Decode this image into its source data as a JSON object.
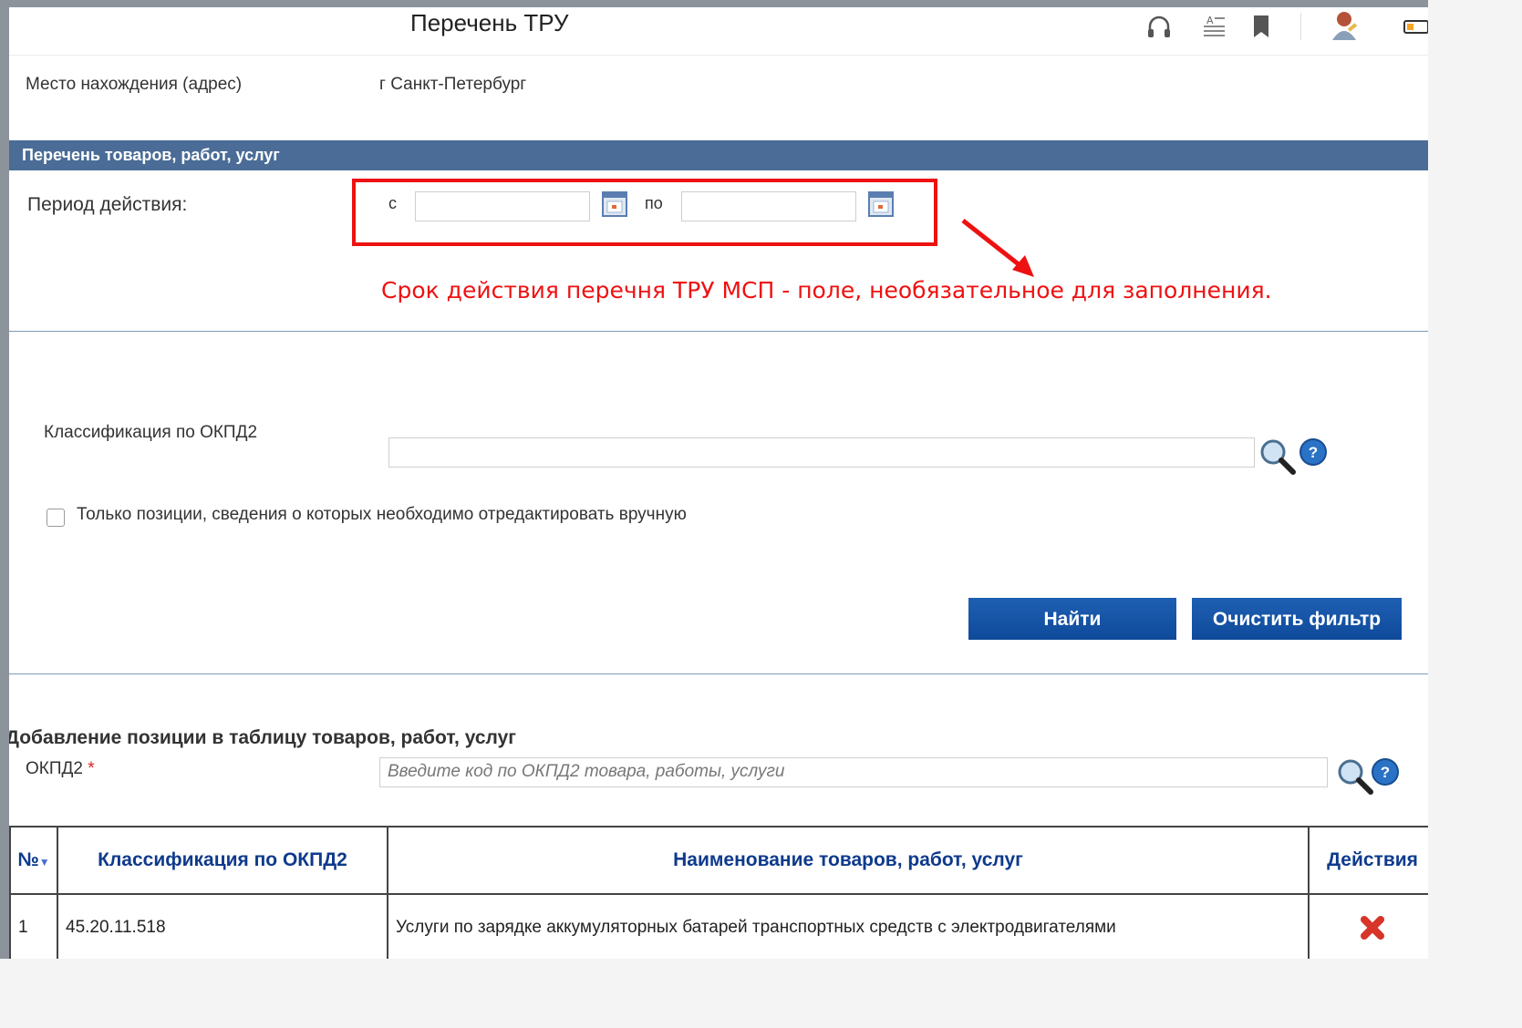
{
  "header": {
    "title": "Перечень ТРУ",
    "icons": [
      "headphones-icon",
      "text-size-icon",
      "bookmark-icon",
      "user-avatar-icon",
      "battery-icon"
    ]
  },
  "location": {
    "label": "Место нахождения (адрес)",
    "value": "г Санкт-Петербург"
  },
  "section": {
    "title": "Перечень товаров, работ, услуг"
  },
  "period": {
    "label": "Период действия:",
    "from_label": "с",
    "to_label": "по",
    "from_value": "",
    "to_value": ""
  },
  "annotation": {
    "text": "Срок действия перечня ТРУ МСП - поле, необязательное для заполнения.",
    "color": "#ee1111"
  },
  "filter": {
    "okpd_label": "Классификация по ОКПД2",
    "okpd_value": "",
    "manual_edit_label": "Только позиции, сведения о которых необходимо отредактировать вручную",
    "manual_edit_checked": false,
    "find_button": "Найти",
    "clear_button": "Очистить фильтр"
  },
  "add_position": {
    "title": "Добавление позиции в таблицу товаров, работ, услуг",
    "okpd_label": "ОКПД2",
    "required_mark": "*",
    "placeholder": "Введите код по ОКПД2 товара, работы, услуги"
  },
  "table": {
    "columns": [
      "№",
      "Классификация по ОКПД2",
      "Наименование товаров, работ, услуг",
      "Действия"
    ],
    "rows": [
      {
        "num": "1",
        "code": "45.20.11.518",
        "name": "Услуги по зарядке аккумуляторных батарей транспортных средств с электродвигателями",
        "action": "delete-icon"
      }
    ]
  },
  "colors": {
    "section_header": "#4a6c96",
    "button": "#1556a8",
    "table_header_text": "#0e3a8c"
  }
}
